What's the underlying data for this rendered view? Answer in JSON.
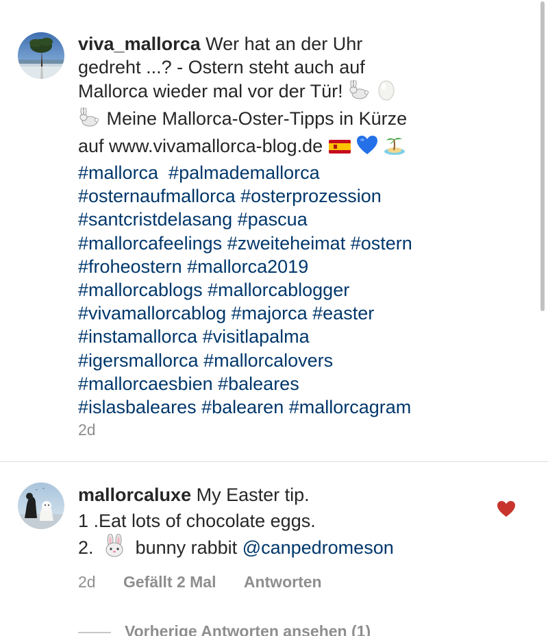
{
  "post_caption": {
    "username": "viva_mallorca",
    "text_lines": [
      "Wer hat an der Uhr",
      "gedreht ...? - Ostern steht auch auf",
      "Mallorca wieder mal vor der Tür!",
      "Meine Mallorca-Oster-Tipps in Kürze",
      "auf www.vivamallorca-blog.de"
    ],
    "hashtag_lines": [
      "#mallorca  #palmademallorca",
      "#osternaufmallorca #osterprozession",
      "#santcristdelasang #pascua",
      "#mallorcafeelings #zweiteheimat #ostern",
      "#froheostern #mallorca2019",
      "#mallorcablogs #mallorcablogger",
      "#vivamallorcablog #majorca #easter",
      "#instamallorca #visitlapalma",
      "#igersmallorca #mallorcalovers",
      "#mallorcaesbien #baleares",
      "#islasbaleares #balearen #mallorcagram"
    ],
    "time": "2d",
    "icons": [
      "rabbit-emoji",
      "egg-emoji",
      "rabbit-emoji",
      "spain-flag-emoji",
      "blue-heart-emoji",
      "desert-island-emoji"
    ]
  },
  "reply_comment": {
    "username": "mallorcaluxe",
    "line1": "My Easter tip.",
    "line2": "1 .Eat lots of chocolate eggs.",
    "line3_prefix": "2.",
    "line3_text": "bunny rabbit",
    "mention": "@canpedromeson",
    "time": "2d",
    "likes": "Gefällt 2 Mal",
    "reply_label": "Antworten",
    "liked": true,
    "icons": [
      "rabbit-face-emoji",
      "heart-icon"
    ]
  },
  "view_replies": "Vorherige Antworten ansehen (1)",
  "colors": {
    "text": "#262626",
    "hashtag": "#00376b",
    "meta": "#8e8e8e",
    "like_heart": "#c7352d",
    "divider": "#dbdbdb"
  }
}
